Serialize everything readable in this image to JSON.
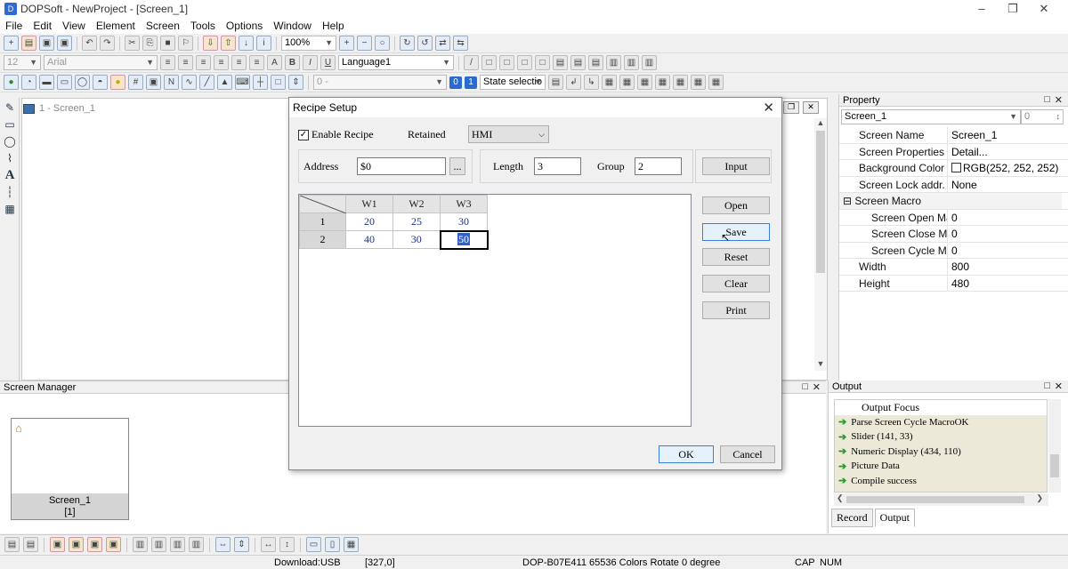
{
  "window": {
    "title": "DOPSoft - NewProject - [Screen_1]",
    "app_icon": "dopsoft-icon"
  },
  "menu": [
    "File",
    "Edit",
    "View",
    "Element",
    "Screen",
    "Tools",
    "Options",
    "Window",
    "Help"
  ],
  "toolbar1": {
    "zoom": "100%"
  },
  "toolbar2": {
    "font_size": "12",
    "font_name": "Arial",
    "language": "Language1"
  },
  "toolbar3": {
    "value_combo": "0 -",
    "state_combo": "State selectio",
    "btn_0": "0",
    "btn_1": "1"
  },
  "editor": {
    "tab_label": "1 - Screen_1"
  },
  "property": {
    "title": "Property",
    "selector": "Screen_1",
    "selector_num": "0",
    "rows": [
      {
        "name": "Screen Name",
        "value": "Screen_1"
      },
      {
        "name": "Screen Properties",
        "value": "Detail..."
      },
      {
        "name": "Background Color",
        "value": "RGB(252, 252, 252)"
      },
      {
        "name": "Screen Lock addr.",
        "value": "None"
      },
      {
        "name": "Screen Macro",
        "value": "",
        "group": true
      },
      {
        "name": "Screen Open Mac",
        "value": "0",
        "sub": true
      },
      {
        "name": "Screen Close Macr",
        "value": "0",
        "sub": true
      },
      {
        "name": "Screen Cycle Macr",
        "value": "0",
        "sub": true
      },
      {
        "name": "Width",
        "value": "800"
      },
      {
        "name": "Height",
        "value": "480"
      }
    ]
  },
  "screen_manager": {
    "title": "Screen Manager",
    "thumb_name": "Screen_1",
    "thumb_index": "[1]"
  },
  "output": {
    "title": "Output",
    "items": [
      "Output Focus",
      "Parse Screen Cycle MacroOK",
      "Slider (141, 33)",
      "Numeric Display (434, 110)",
      "Picture Data",
      "Compile success"
    ],
    "tabs": [
      "Record",
      "Output"
    ]
  },
  "status": {
    "download": "Download:USB",
    "coords": "[327,0]",
    "device": "DOP-B07E411 65536 Colors Rotate 0 degree",
    "cap": "CAP",
    "num": "NUM"
  },
  "dialog": {
    "title": "Recipe Setup",
    "enable_recipe": "Enable Recipe",
    "enable_checked": true,
    "retained_label": "Retained",
    "retained_value": "HMI",
    "address_label": "Address",
    "address_value": "$0",
    "browse": "...",
    "length_label": "Length",
    "length_value": "3",
    "group_label": "Group",
    "group_value": "2",
    "buttons": {
      "input": "Input",
      "open": "Open",
      "save": "Save",
      "reset": "Reset",
      "clear": "Clear",
      "print": "Print",
      "ok": "OK",
      "cancel": "Cancel"
    },
    "grid": {
      "columns": [
        "W1",
        "W2",
        "W3"
      ],
      "rows": [
        {
          "label": "1",
          "values": [
            "20",
            "25",
            "30"
          ]
        },
        {
          "label": "2",
          "values": [
            "40",
            "30",
            "50"
          ]
        }
      ]
    }
  }
}
